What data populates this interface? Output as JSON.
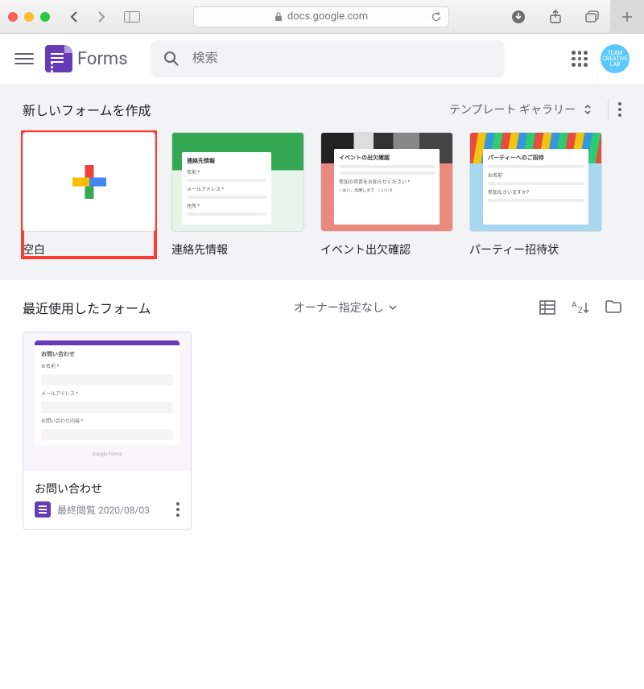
{
  "browser": {
    "url": "docs.google.com"
  },
  "header": {
    "appName": "Forms",
    "searchPlaceholder": "検索",
    "avatarText": "TEAM CREATIVE LAB"
  },
  "templates": {
    "heading": "新しいフォームを作成",
    "galleryLabel": "テンプレート ギャラリー",
    "cards": [
      {
        "label": "空白"
      },
      {
        "label": "連絡先情報",
        "thumbTitle": "連絡先情報"
      },
      {
        "label": "イベント出欠確認",
        "thumbTitle": "イベントの出欠確認"
      },
      {
        "label": "パーティー招待状",
        "thumbTitle": "パーティーへのご招待"
      }
    ]
  },
  "recent": {
    "heading": "最近使用したフォーム",
    "ownerFilter": "オーナー指定なし",
    "cards": [
      {
        "name": "お問い合わせ",
        "date": "最終閲覧 2020/08/03",
        "thumbTitle": "お問い合わせ"
      }
    ]
  }
}
